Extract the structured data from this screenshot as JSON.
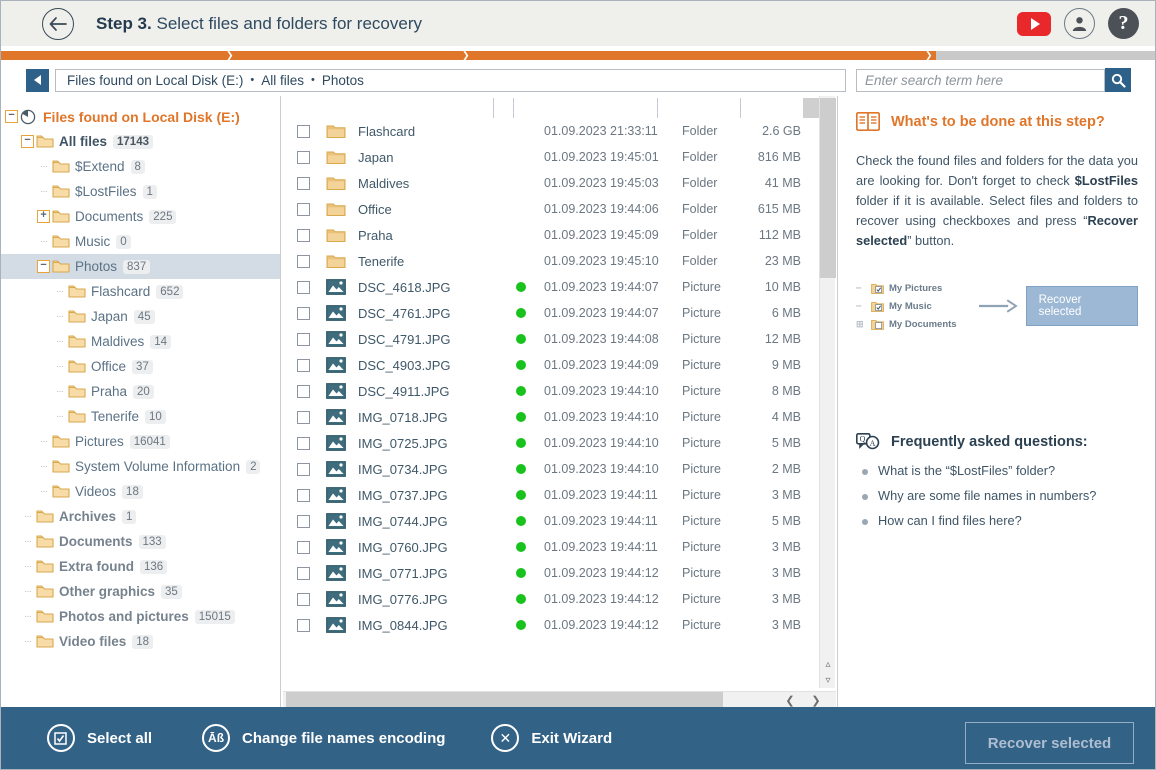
{
  "header": {
    "back_icon": "arrow-left-icon",
    "step_number": "Step 3.",
    "step_title": "Select files and folders for recovery",
    "youtube_icon": "youtube-icon",
    "account_icon": "account-icon",
    "help_icon": "help-icon",
    "help_glyph": "?"
  },
  "progress": {
    "percent": 81,
    "fill_color": "#e0762a",
    "track_color": "#c9c9c9"
  },
  "breadcrumb": {
    "back_icon": "triangle-left-icon",
    "parts": [
      "Files found on Local Disk (E:)",
      "All files",
      "Photos"
    ],
    "separator": "•"
  },
  "search": {
    "value": "",
    "placeholder": "Enter search term here",
    "button_icon": "search-icon"
  },
  "sidebar": {
    "items": [
      {
        "label": "Files found on Local Disk (E:)",
        "count": "",
        "indent": 0,
        "twisty": "minus",
        "icon": "disk-scan-icon",
        "style": "root",
        "selected": false
      },
      {
        "label": "All files",
        "count": "17143",
        "indent": 1,
        "twisty": "minus",
        "icon": "folder-icon",
        "style": "lvl1",
        "selected": false,
        "badge_strong": true
      },
      {
        "label": "$Extend",
        "count": "8",
        "indent": 2,
        "twisty": "dots",
        "icon": "folder-icon",
        "style": "lvl2",
        "selected": false
      },
      {
        "label": "$LostFiles",
        "count": "1",
        "indent": 2,
        "twisty": "dots",
        "icon": "folder-icon",
        "style": "lvl2",
        "selected": false
      },
      {
        "label": "Documents",
        "count": "225",
        "indent": 2,
        "twisty": "plus",
        "icon": "folder-icon",
        "style": "lvl2",
        "selected": false
      },
      {
        "label": "Music",
        "count": "0",
        "indent": 2,
        "twisty": "dots",
        "icon": "folder-icon",
        "style": "lvl2",
        "selected": false
      },
      {
        "label": "Photos",
        "count": "837",
        "indent": 2,
        "twisty": "minus",
        "icon": "folder-icon",
        "style": "lvl2",
        "selected": true
      },
      {
        "label": "Flashcard",
        "count": "652",
        "indent": 3,
        "twisty": "dots",
        "icon": "folder-icon",
        "style": "lvl2",
        "selected": false
      },
      {
        "label": "Japan",
        "count": "45",
        "indent": 3,
        "twisty": "dots",
        "icon": "folder-icon",
        "style": "lvl2",
        "selected": false
      },
      {
        "label": "Maldives",
        "count": "14",
        "indent": 3,
        "twisty": "dots",
        "icon": "folder-icon",
        "style": "lvl2",
        "selected": false
      },
      {
        "label": "Office",
        "count": "37",
        "indent": 3,
        "twisty": "dots",
        "icon": "folder-icon",
        "style": "lvl2",
        "selected": false
      },
      {
        "label": "Praha",
        "count": "20",
        "indent": 3,
        "twisty": "dots",
        "icon": "folder-icon",
        "style": "lvl2",
        "selected": false
      },
      {
        "label": "Tenerife",
        "count": "10",
        "indent": 3,
        "twisty": "dots",
        "icon": "folder-icon",
        "style": "lvl2",
        "selected": false
      },
      {
        "label": "Pictures",
        "count": "16041",
        "indent": 2,
        "twisty": "dots",
        "icon": "folder-icon",
        "style": "lvl2",
        "selected": false
      },
      {
        "label": "System Volume Information",
        "count": "2",
        "indent": 2,
        "twisty": "dots",
        "icon": "folder-icon",
        "style": "lvl2",
        "selected": false
      },
      {
        "label": "Videos",
        "count": "18",
        "indent": 2,
        "twisty": "dots",
        "icon": "folder-icon",
        "style": "lvl2",
        "selected": false
      },
      {
        "label": "Archives",
        "count": "1",
        "indent": 1,
        "twisty": "dots",
        "icon": "folder-icon",
        "style": "bold-gray",
        "selected": false
      },
      {
        "label": "Documents",
        "count": "133",
        "indent": 1,
        "twisty": "dots",
        "icon": "folder-icon",
        "style": "bold-gray",
        "selected": false
      },
      {
        "label": "Extra found",
        "count": "136",
        "indent": 1,
        "twisty": "dots",
        "icon": "folder-icon",
        "style": "bold-gray",
        "selected": false
      },
      {
        "label": "Other graphics",
        "count": "35",
        "indent": 1,
        "twisty": "dots",
        "icon": "folder-icon",
        "style": "bold-gray",
        "selected": false
      },
      {
        "label": "Photos and pictures",
        "count": "15015",
        "indent": 1,
        "twisty": "dots",
        "icon": "folder-icon",
        "style": "bold-gray",
        "selected": false
      },
      {
        "label": "Video files",
        "count": "18",
        "indent": 1,
        "twisty": "dots",
        "icon": "folder-icon",
        "style": "bold-gray",
        "selected": false
      }
    ]
  },
  "filelist": {
    "checked_all": false,
    "status_dot_color": "#19c21c",
    "rows": [
      {
        "name": "Flashcard",
        "icon": "folder-icon",
        "dot": false,
        "date": "01.09.2023 21:33:11",
        "type": "Folder",
        "size": "2.6 GB",
        "checked": false
      },
      {
        "name": "Japan",
        "icon": "folder-icon",
        "dot": false,
        "date": "01.09.2023 19:45:01",
        "type": "Folder",
        "size": "816 MB",
        "checked": false
      },
      {
        "name": "Maldives",
        "icon": "folder-icon",
        "dot": false,
        "date": "01.09.2023 19:45:03",
        "type": "Folder",
        "size": "41 MB",
        "checked": false
      },
      {
        "name": "Office",
        "icon": "folder-icon",
        "dot": false,
        "date": "01.09.2023 19:44:06",
        "type": "Folder",
        "size": "615 MB",
        "checked": false
      },
      {
        "name": "Praha",
        "icon": "folder-icon",
        "dot": false,
        "date": "01.09.2023 19:45:09",
        "type": "Folder",
        "size": "112 MB",
        "checked": false
      },
      {
        "name": "Tenerife",
        "icon": "folder-icon",
        "dot": false,
        "date": "01.09.2023 19:45:10",
        "type": "Folder",
        "size": "23 MB",
        "checked": false
      },
      {
        "name": "DSC_4618.JPG",
        "icon": "picture-icon",
        "dot": true,
        "date": "01.09.2023 19:44:07",
        "type": "Picture",
        "size": "10 MB",
        "checked": false
      },
      {
        "name": "DSC_4761.JPG",
        "icon": "picture-icon",
        "dot": true,
        "date": "01.09.2023 19:44:07",
        "type": "Picture",
        "size": "6 MB",
        "checked": false
      },
      {
        "name": "DSC_4791.JPG",
        "icon": "picture-icon",
        "dot": true,
        "date": "01.09.2023 19:44:08",
        "type": "Picture",
        "size": "12 MB",
        "checked": false
      },
      {
        "name": "DSC_4903.JPG",
        "icon": "picture-icon",
        "dot": true,
        "date": "01.09.2023 19:44:09",
        "type": "Picture",
        "size": "9 MB",
        "checked": false
      },
      {
        "name": "DSC_4911.JPG",
        "icon": "picture-icon",
        "dot": true,
        "date": "01.09.2023 19:44:10",
        "type": "Picture",
        "size": "8 MB",
        "checked": false
      },
      {
        "name": "IMG_0718.JPG",
        "icon": "picture-icon",
        "dot": true,
        "date": "01.09.2023 19:44:10",
        "type": "Picture",
        "size": "4 MB",
        "checked": false
      },
      {
        "name": "IMG_0725.JPG",
        "icon": "picture-icon",
        "dot": true,
        "date": "01.09.2023 19:44:10",
        "type": "Picture",
        "size": "5 MB",
        "checked": false
      },
      {
        "name": "IMG_0734.JPG",
        "icon": "picture-icon",
        "dot": true,
        "date": "01.09.2023 19:44:10",
        "type": "Picture",
        "size": "2 MB",
        "checked": false
      },
      {
        "name": "IMG_0737.JPG",
        "icon": "picture-icon",
        "dot": true,
        "date": "01.09.2023 19:44:11",
        "type": "Picture",
        "size": "3 MB",
        "checked": false
      },
      {
        "name": "IMG_0744.JPG",
        "icon": "picture-icon",
        "dot": true,
        "date": "01.09.2023 19:44:11",
        "type": "Picture",
        "size": "5 MB",
        "checked": false
      },
      {
        "name": "IMG_0760.JPG",
        "icon": "picture-icon",
        "dot": true,
        "date": "01.09.2023 19:44:11",
        "type": "Picture",
        "size": "3 MB",
        "checked": false
      },
      {
        "name": "IMG_0771.JPG",
        "icon": "picture-icon",
        "dot": true,
        "date": "01.09.2023 19:44:12",
        "type": "Picture",
        "size": "3 MB",
        "checked": false
      },
      {
        "name": "IMG_0776.JPG",
        "icon": "picture-icon",
        "dot": true,
        "date": "01.09.2023 19:44:12",
        "type": "Picture",
        "size": "3 MB",
        "checked": false
      },
      {
        "name": "IMG_0844.JPG",
        "icon": "picture-icon",
        "dot": true,
        "date": "01.09.2023 19:44:12",
        "type": "Picture",
        "size": "3 MB",
        "checked": false
      }
    ],
    "scroll": {
      "up_icon": "chevron-up-icon",
      "down_icon": "chevron-down-icon",
      "left_icon": "chevron-left-icon",
      "right_icon": "chevron-right-icon"
    }
  },
  "help": {
    "book_icon": "book-icon",
    "title": "What's to be done at this step?",
    "body_1": "Check the found files and folders for the data you are looking for. Don't forget to check ",
    "body_bold_1": "$LostFiles",
    "body_2": " folder if it is available. Select files and folders to recover using checkboxes and press “",
    "body_bold_2": "Recover selected",
    "body_3": "” button.",
    "illustration": {
      "items": [
        "My Pictures",
        "My Music",
        "My Documents"
      ],
      "arrow_icon": "arrow-right-icon",
      "button_label": "Recover selected",
      "cursor_icon": "cursor-icon"
    },
    "faq_icon": "faq-icon",
    "faq_title": "Frequently asked questions:",
    "faq_items": [
      "What is the “$LostFiles” folder?",
      "Why are some file names in numbers?",
      "How can I find files here?"
    ]
  },
  "bottom": {
    "select_all_icon": "select-all-icon",
    "select_all_label": "Select all",
    "encoding_icon": "encoding-icon",
    "encoding_glyph": "Āß",
    "encoding_label": "Change file names encoding",
    "exit_icon": "close-icon",
    "exit_glyph": "✕",
    "exit_label": "Exit Wizard",
    "recover_label": "Recover selected"
  }
}
